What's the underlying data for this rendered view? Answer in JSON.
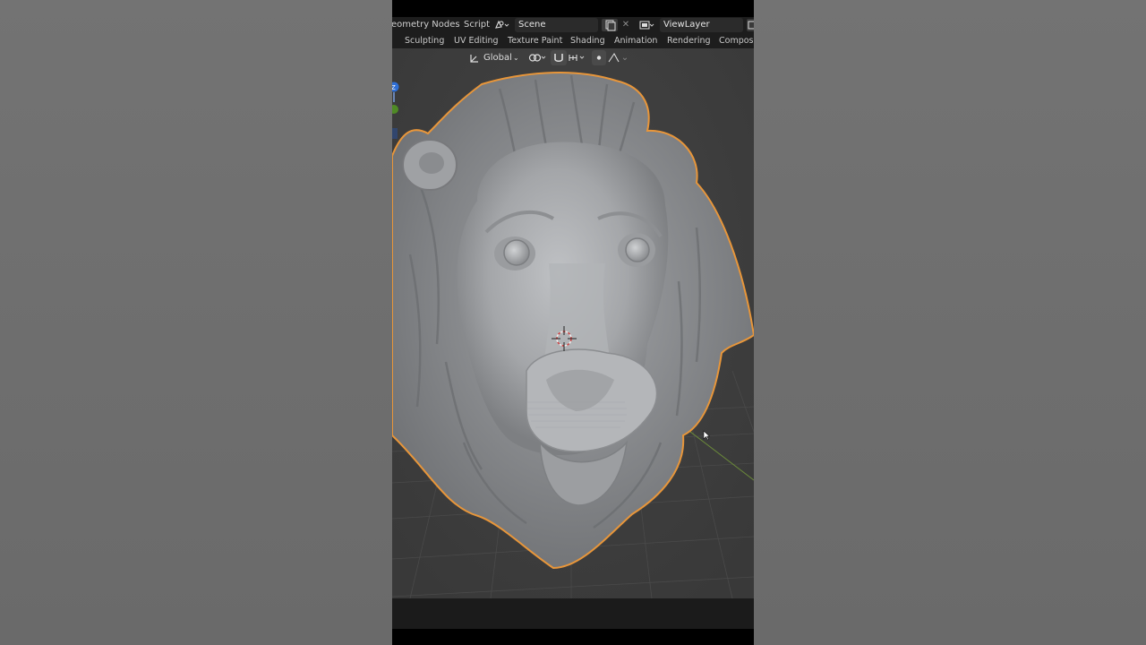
{
  "topbar": {
    "workspace_left_partial": "eometry Nodes",
    "workspace_script": "Script",
    "scene_name": "Scene",
    "view_layer": "ViewLayer"
  },
  "workspaces": [
    "Sculpting",
    "UV Editing",
    "Texture Paint",
    "Shading",
    "Animation",
    "Rendering",
    "Composit"
  ],
  "toolbar": {
    "transform_orientation": "Global"
  },
  "gizmo": {
    "axis_z_label": "Z"
  },
  "colors": {
    "selection_outline": "#e8963a",
    "viewport_bg": "#3d3d3d",
    "header_bg": "#1d1d1d",
    "mesh": "#a9abae"
  }
}
